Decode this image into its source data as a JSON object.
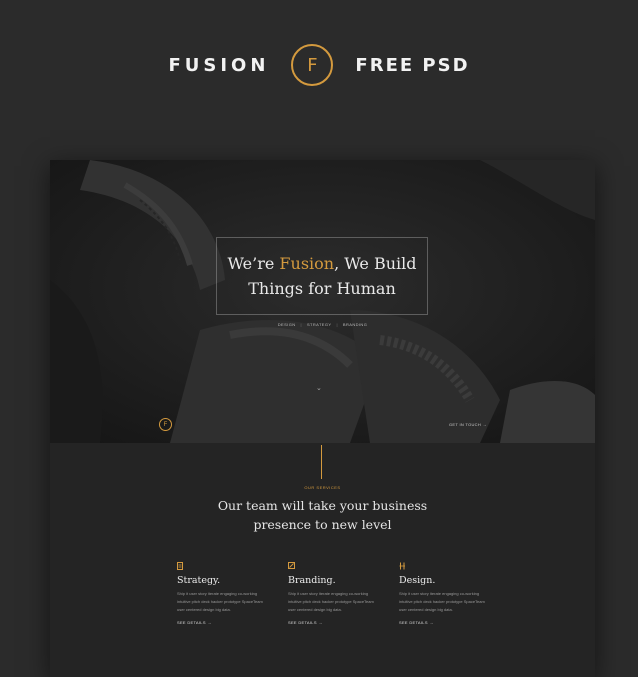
{
  "banner": {
    "left_word": "FUSION",
    "logo_letter": "F",
    "right_word": "FREE PSD",
    "accent_color": "#d49a3e"
  },
  "hero": {
    "headline_part1": "We’re ",
    "headline_accent": "Fusion",
    "headline_part2": ", We Build",
    "headline_line2": "Things for Human",
    "tags": [
      "DESIGN",
      "STRATEGY",
      "BRANDING"
    ],
    "tag_separator": "|",
    "scroll_icon": "chevron-down-icon",
    "logo_letter": "F",
    "contact_link": "GET IN TOUCH →"
  },
  "services": {
    "label": "OUR SERVICES",
    "title_line1": "Our team will take your business",
    "title_line2": "presence to new level",
    "items": [
      {
        "icon": "document-icon",
        "title": "Strategy.",
        "body": "Ship it user story iterate engaging co-working intuitive pitch deck hacker prototype SpaceTeam user centered design big data.",
        "link": "SEE DETAILS →"
      },
      {
        "icon": "pen-box-icon",
        "title": "Branding.",
        "body": "Ship it user story iterate engaging co-working intuitive pitch deck hacker prototype SpaceTeam user centered design big data.",
        "link": "SEE DETAILS →"
      },
      {
        "icon": "tools-icon",
        "title": "Design.",
        "body": "Ship it user story iterate engaging co-working intuitive pitch deck hacker prototype SpaceTeam user centered design big data.",
        "link": "SEE DETAILS →"
      }
    ]
  }
}
